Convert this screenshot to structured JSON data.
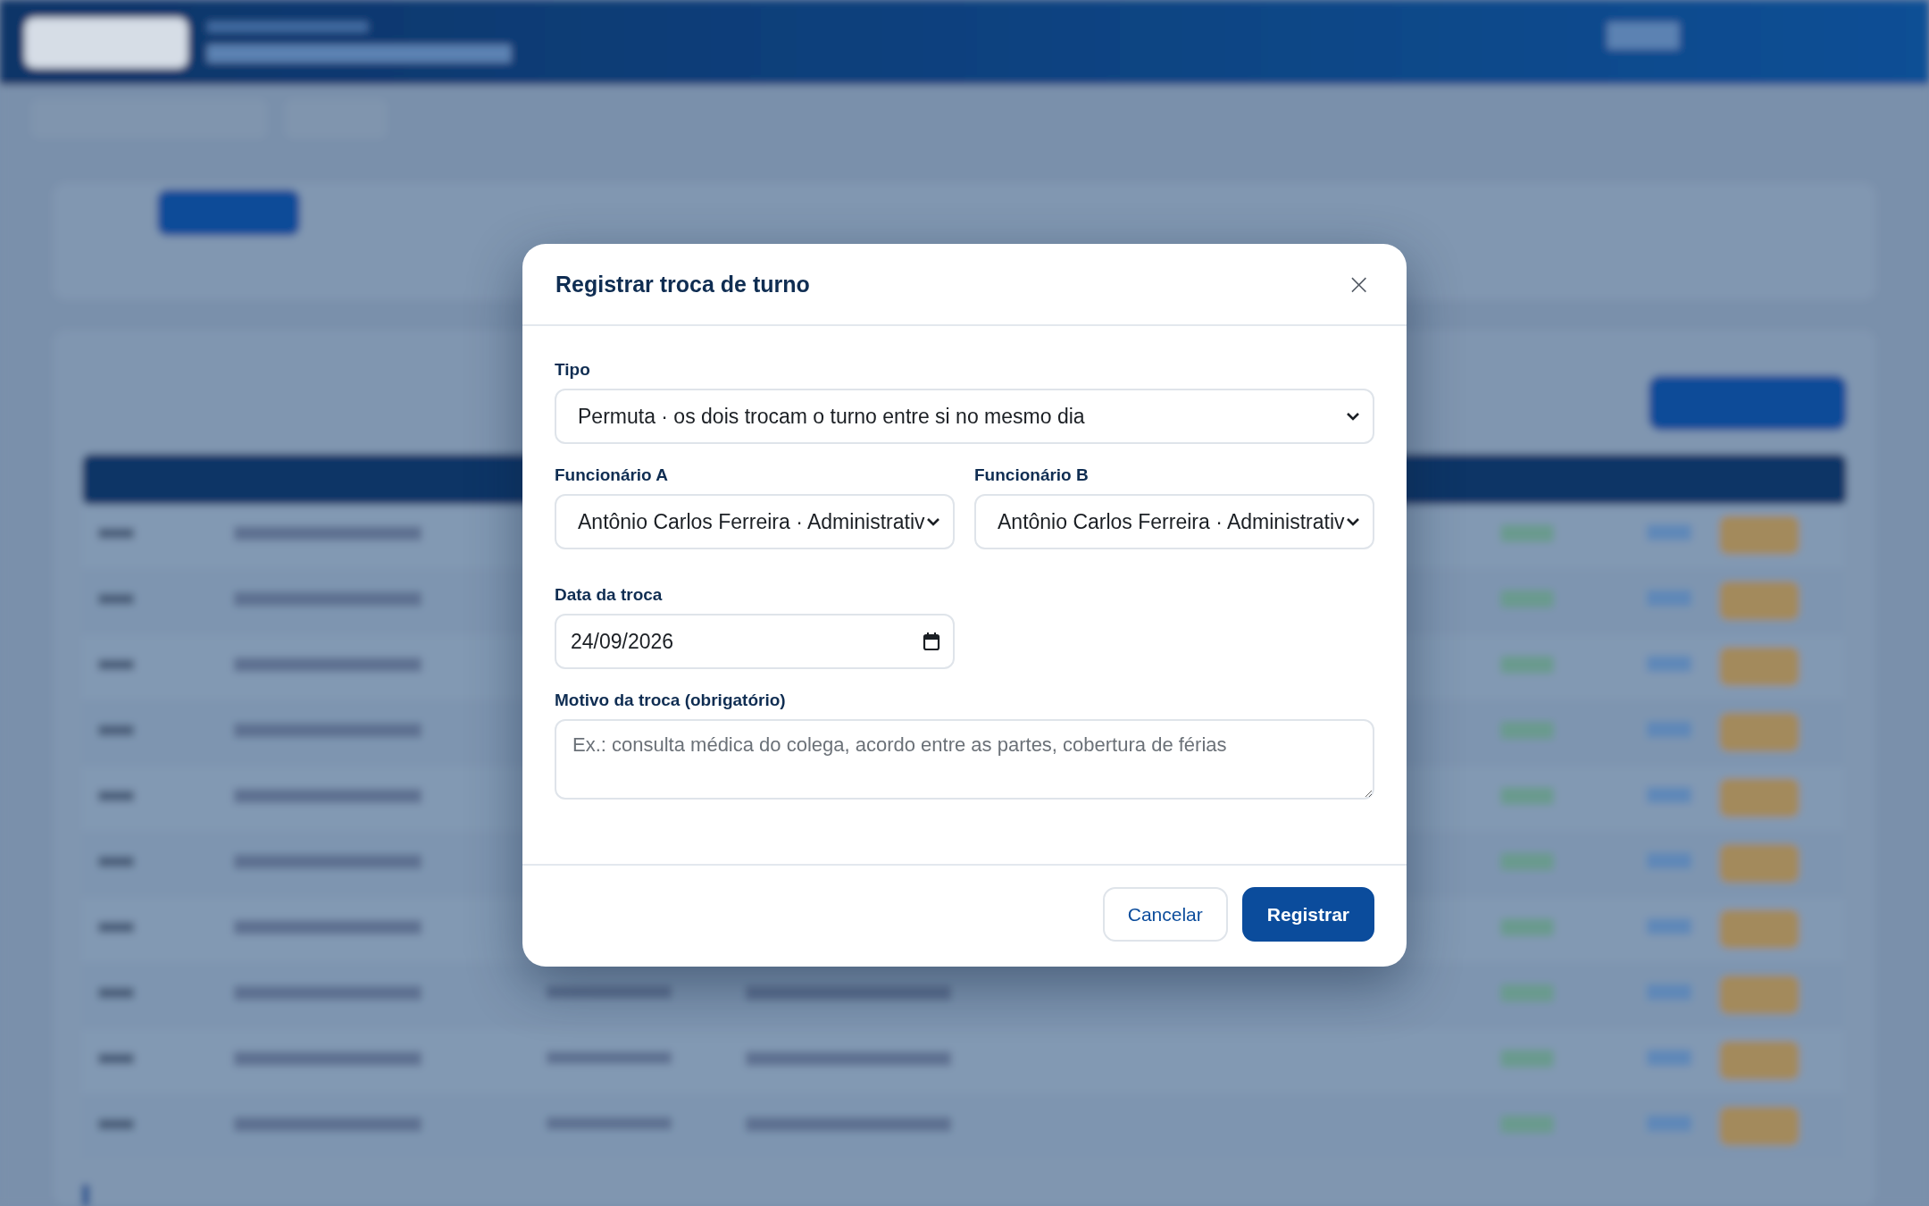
{
  "dialog": {
    "title": "Registrar troca de turno",
    "close": "×",
    "fields": [
      {
        "kind": "select",
        "label": "Tipo",
        "value": "Permuta · os dois trocam o turno entre si no mesmo dia"
      },
      {
        "kind": "select",
        "label": "Funcionário A",
        "value": "Antônio Carlos Ferreira · Administrativ"
      },
      {
        "kind": "select",
        "label": "Funcionário B",
        "value": "Antônio Carlos Ferreira · Administrativ"
      },
      {
        "kind": "date",
        "label": "Data da troca",
        "value": "24/09/2026"
      },
      {
        "kind": "textarea",
        "label": "Motivo da troca (obrigatório)",
        "placeholder": "Ex.: consulta médica do colega, acordo entre as partes, cobertura de férias"
      }
    ],
    "buttons": [
      {
        "label": "Cancelar",
        "kind": "secondary"
      },
      {
        "label": "Registrar",
        "kind": "primary"
      }
    ]
  }
}
